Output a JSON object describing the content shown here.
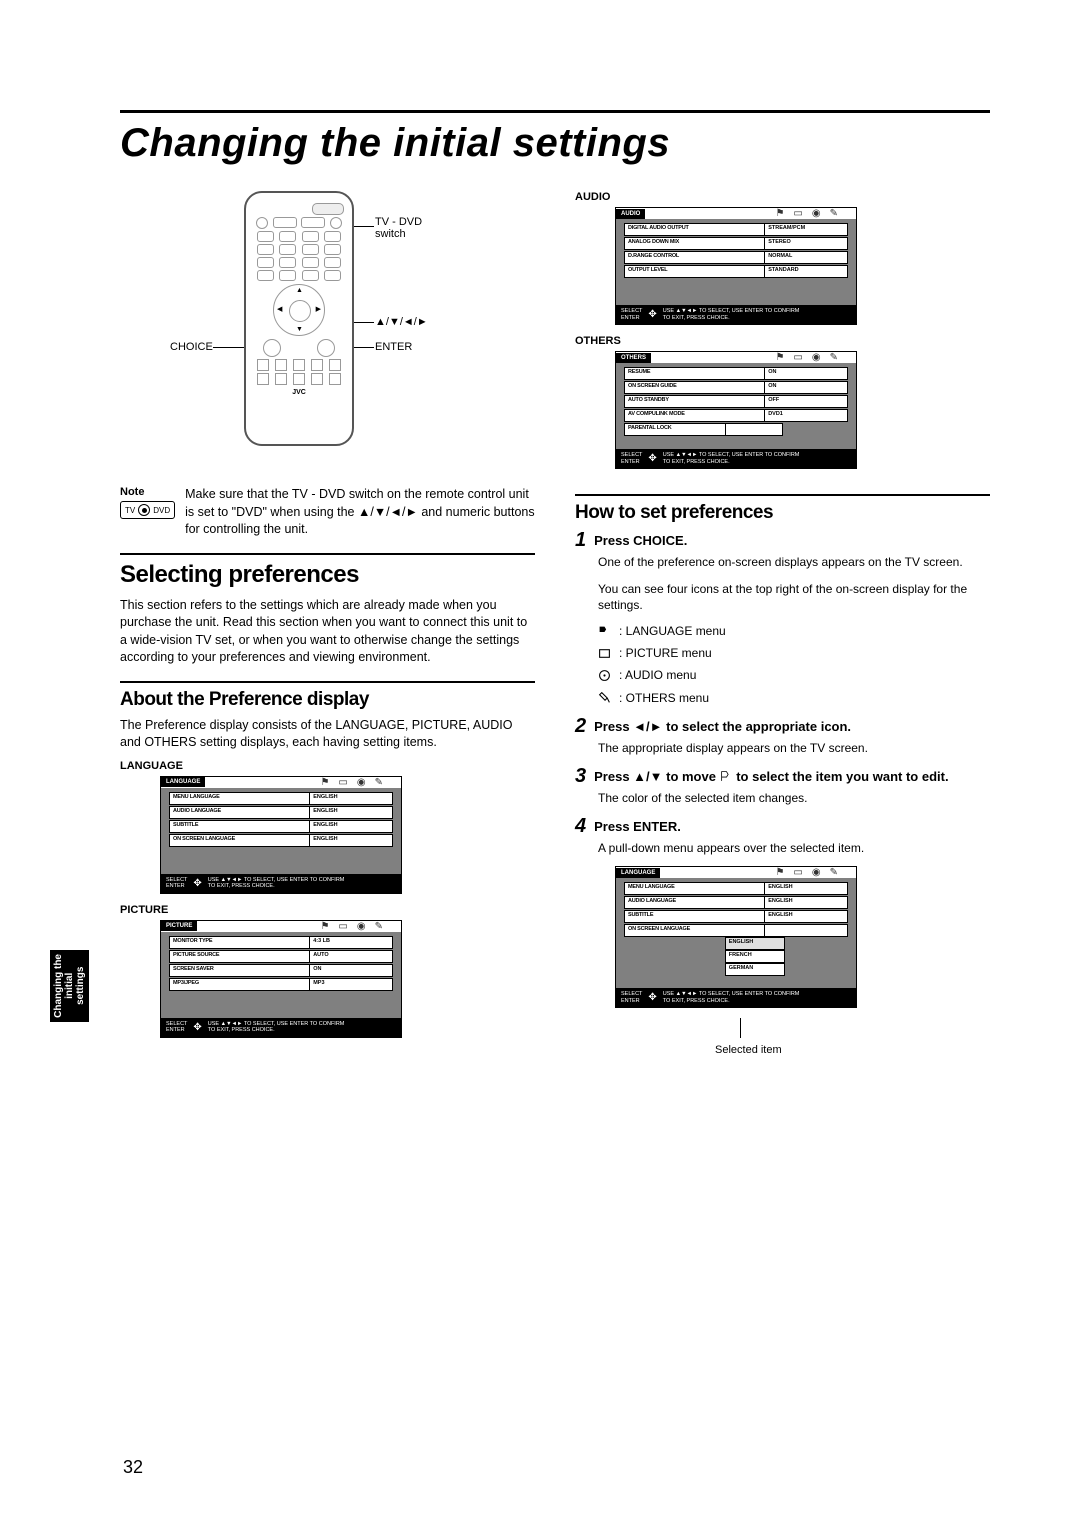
{
  "page_title": "Changing the initial settings",
  "page_number": "32",
  "side_tab": "Changing the\ninitial\nsettings",
  "remote": {
    "switch_label": "TV - DVD\nswitch",
    "arrows_label": "▲/▼/◄/►",
    "choice_label": "CHOICE",
    "enter_label": "ENTER",
    "brand": "JVC"
  },
  "note": {
    "heading": "Note",
    "pill_left": "TV",
    "pill_right": "DVD",
    "text": "Make sure that the TV - DVD switch on the remote control unit is set to \"DVD\" when using the ▲/▼/◄/► and numeric buttons for controlling the unit."
  },
  "selecting": {
    "title": "Selecting preferences",
    "para": "This section refers to the settings which are already made when you purchase the unit. Read this section when you want to connect this unit to a wide-vision TV set, or when you want to otherwise change the settings according to your preferences and viewing environment."
  },
  "about": {
    "title": "About the Preference display",
    "para": "The Preference display consists of the LANGUAGE, PICTURE, AUDIO and OTHERS setting displays, each having setting items."
  },
  "osd_common": {
    "footer_select": "SELECT",
    "footer_enter": "ENTER",
    "footer_hint1": "USE ▲▼◄► TO SELECT, USE ENTER TO CONFIRM",
    "footer_hint2": "TO EXIT, PRESS CHOICE."
  },
  "language": {
    "label": "LANGUAGE",
    "tab": "LANGUAGE",
    "rows": [
      {
        "k": "MENU LANGUAGE",
        "v": "ENGLISH"
      },
      {
        "k": "AUDIO LANGUAGE",
        "v": "ENGLISH"
      },
      {
        "k": "SUBTITLE",
        "v": "ENGLISH"
      },
      {
        "k": "ON SCREEN LANGUAGE",
        "v": "ENGLISH"
      }
    ]
  },
  "picture": {
    "label": "PICTURE",
    "tab": "PICTURE",
    "rows": [
      {
        "k": "MONITOR TYPE",
        "v": "4:3 LB"
      },
      {
        "k": "PICTURE SOURCE",
        "v": "AUTO"
      },
      {
        "k": "SCREEN SAVER",
        "v": "ON"
      },
      {
        "k": "MP3/JPEG",
        "v": "MP3"
      }
    ]
  },
  "audio": {
    "label": "AUDIO",
    "tab": "AUDIO",
    "rows": [
      {
        "k": "DIGITAL AUDIO OUTPUT",
        "v": "STREAM/PCM"
      },
      {
        "k": "ANALOG DOWN MIX",
        "v": "STEREO"
      },
      {
        "k": "D.RANGE CONTROL",
        "v": "NORMAL"
      },
      {
        "k": "OUTPUT LEVEL",
        "v": "STANDARD"
      }
    ]
  },
  "others": {
    "label": "OTHERS",
    "tab": "OTHERS",
    "rows": [
      {
        "k": "RESUME",
        "v": "ON"
      },
      {
        "k": "ON SCREEN GUIDE",
        "v": "ON"
      },
      {
        "k": "AUTO STANDBY",
        "v": "OFF"
      },
      {
        "k": "AV COMPULINK MODE",
        "v": "DVD1"
      },
      {
        "k": "PARENTAL LOCK",
        "v": ""
      }
    ]
  },
  "howto": {
    "title": "How to set preferences",
    "step1_title": "Press CHOICE.",
    "step1_p1": "One of the preference on-screen displays appears on the TV screen.",
    "step1_p2": "You can see four icons at the top right of the on-screen display for the settings.",
    "menu_lang": ": LANGUAGE menu",
    "menu_pic": ": PICTURE menu",
    "menu_audio": ": AUDIO menu",
    "menu_others": ": OTHERS menu",
    "step2_title": "Press ◄/► to select the appropriate icon.",
    "step2_p": "The appropriate display appears on the TV screen.",
    "step3_title_a": "Press ▲/▼ to move ",
    "step3_title_b": " to select the item you want to edit.",
    "step3_p": "The color of the selected item changes.",
    "step4_title": "Press ENTER.",
    "step4_p": "A pull-down menu appears over the selected item."
  },
  "pulldown_osd": {
    "tab": "LANGUAGE",
    "rows": [
      {
        "k": "MENU LANGUAGE",
        "v": "ENGLISH"
      },
      {
        "k": "AUDIO LANGUAGE",
        "v": "ENGLISH"
      },
      {
        "k": "SUBTITLE",
        "v": "ENGLISH"
      },
      {
        "k": "ON SCREEN LANGUAGE",
        "v": ""
      }
    ],
    "options": [
      "ENGLISH",
      "FRENCH",
      "GERMAN"
    ],
    "callout": "Selected item"
  }
}
